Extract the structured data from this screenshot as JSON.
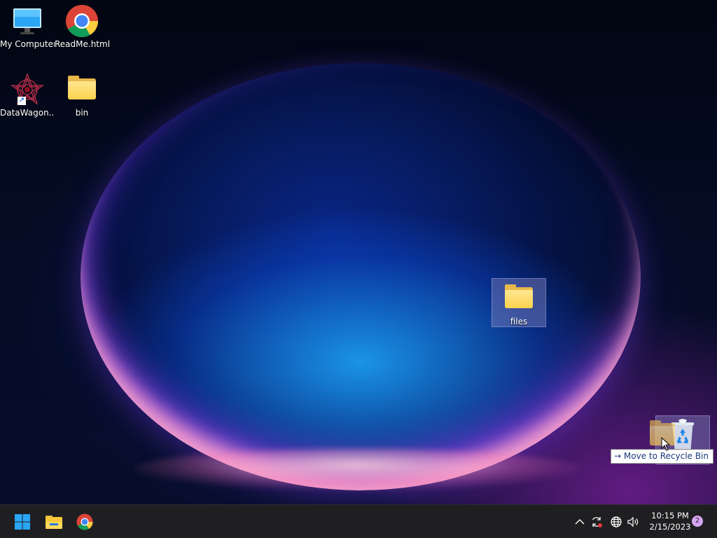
{
  "desktop": {
    "icons": [
      {
        "label": "My Computer",
        "icon": "monitor-icon"
      },
      {
        "label": "ReadMe.html",
        "icon": "chrome-icon"
      },
      {
        "label": "DataWagon...",
        "icon": "datawagon-shortcut-icon"
      },
      {
        "label": "bin",
        "icon": "folder-icon"
      },
      {
        "label": "files",
        "icon": "folder-icon",
        "selected": true
      },
      {
        "label": "",
        "icon": "recycle-bin-icon",
        "selected": true
      }
    ],
    "drag": {
      "tooltip_arrow": "→",
      "tooltip_text": "Move to Recycle Bin"
    }
  },
  "taskbar": {
    "apps": [
      {
        "icon": "windows-start-icon"
      },
      {
        "icon": "file-explorer-icon"
      },
      {
        "icon": "chrome-icon"
      }
    ],
    "tray": {
      "icons": [
        "chevron-up-icon",
        "sync-icon",
        "globe-icon",
        "volume-icon"
      ],
      "time": "10:15 PM",
      "date": "2/15/2023",
      "notification_count": "2"
    }
  },
  "colors": {
    "taskbar_bg": "#1f1f22",
    "folder_yellow": "#fcd24e",
    "windows_blue": "#2aa6f5",
    "notification_badge": "#d7a6f2"
  }
}
